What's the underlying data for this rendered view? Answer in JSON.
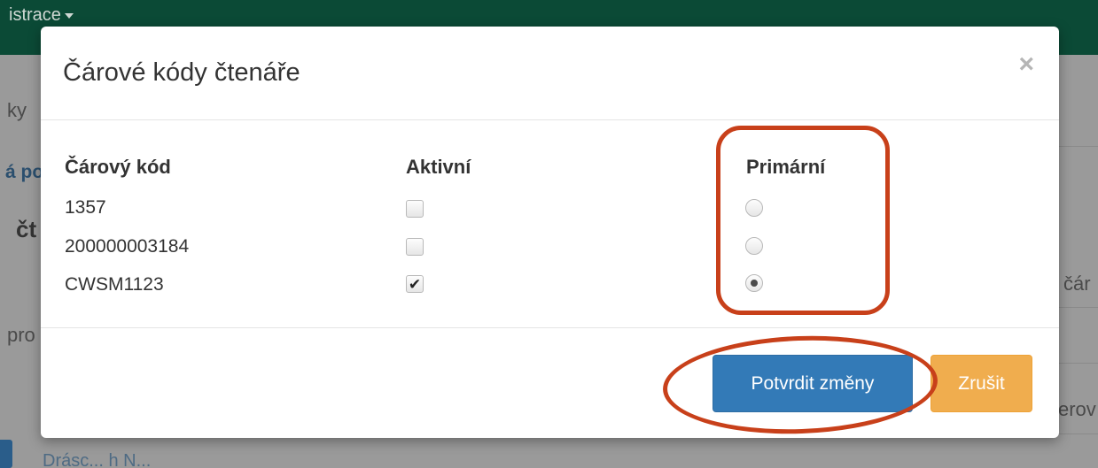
{
  "background": {
    "menu_label": "istrace",
    "left_fragments": [
      "ky",
      "á po",
      "čt",
      "pro"
    ],
    "right_fragments": [
      "čár",
      "erov"
    ],
    "bottom_fragment": "Drásc... h N..."
  },
  "modal": {
    "title": "Čárové kódy čtenáře",
    "close_symbol": "×",
    "columns": {
      "barcode": "Čárový kód",
      "active": "Aktivní",
      "primary": "Primární"
    },
    "rows": [
      {
        "barcode": "1357",
        "active": false,
        "primary": false
      },
      {
        "barcode": "200000003184",
        "active": false,
        "primary": false
      },
      {
        "barcode": "CWSM1123",
        "active": true,
        "primary": true
      }
    ],
    "confirm_label": "Potvrdit změny",
    "cancel_label": "Zrušit"
  },
  "colors": {
    "topbar": "#0b4a36",
    "primary_button": "#337ab7",
    "warning_button": "#f0ad4e",
    "annotation": "#c8401a"
  },
  "icons": {
    "checked": "✔"
  }
}
